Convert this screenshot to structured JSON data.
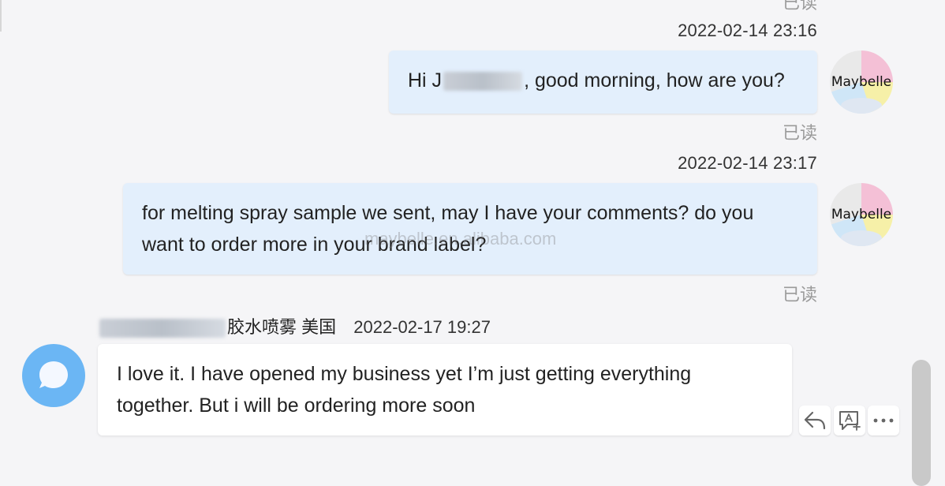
{
  "read_label": "已读",
  "messages": [
    {
      "timestamp": "2022-02-14 23:16",
      "text_before": "Hi J",
      "text_after": ", good morning, how are you?",
      "status": "已读"
    },
    {
      "timestamp": "2022-02-14 23:17",
      "text": "for melting spray sample we sent, may I have your comments? do you want to order more in your brand label?",
      "status": "已读"
    },
    {
      "sender_suffix": "胶水喷雾 美国",
      "timestamp": "2022-02-17 19:27",
      "text": "I love it. I have opened my business yet I’m just getting everything together. But i will be ordering more soon"
    }
  ],
  "avatar_logo_text": "Maybelle",
  "watermark": "maybelle.en.alibaba.com",
  "actions": [
    "reply-icon",
    "translate-icon",
    "more-icon"
  ],
  "colors": {
    "outgoing_bubble": "#e3effc",
    "incoming_bubble": "#ffffff",
    "user_avatar": "#6bb6f4"
  }
}
